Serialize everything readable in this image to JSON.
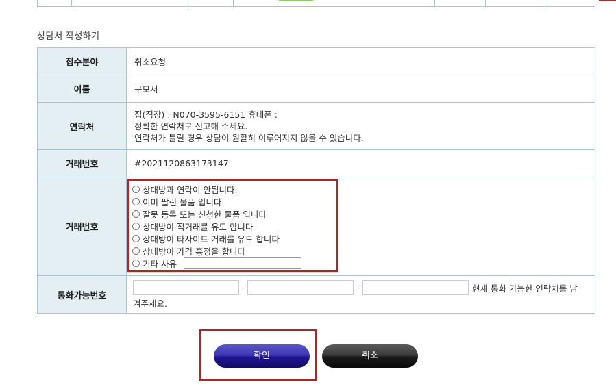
{
  "section_title": "상담서 작성하기",
  "form": {
    "field_label": "접수분야",
    "field_value": "취소요청",
    "name_label": "이름",
    "name_value": "구모서",
    "contact_label": "연락처",
    "contact_line1": "집(직장) : N070-3595-6151   휴대폰 :",
    "contact_line2": "정확한 연락처로 신고해 주세요.",
    "contact_line3": "연락처가 틀릴 경우 상담이 원활히 이루어지지 않을 수 있습니다.",
    "trade_label": "거래번호",
    "trade_value": "#2021120863173147",
    "reason_label": "거래번호",
    "reasons": [
      "상대방과 연락이 안됩니다.",
      "이미 팔린 물품 입니다",
      "잘못 등록 또는 신청한 물품 입니다",
      "상대방이 직거래를 유도 합니다",
      "상대방이 타사이트 거래를 유도 합니다",
      "상대방이 가격 흥정을 합니다",
      "기타 사유"
    ],
    "phone_label": "통화가능번호",
    "phone_dash": "-",
    "phone_note_part1": "현재 통화 가능한 연락처를 남",
    "phone_note_part2": "겨주세요."
  },
  "buttons": {
    "confirm": "확인",
    "cancel": "취소"
  },
  "colors": {
    "header_bg": "#e4eff4",
    "border": "#a9c6d4",
    "highlight": "#e01010",
    "confirm_button": "#2a1fa0",
    "cancel_button": "#222222"
  }
}
